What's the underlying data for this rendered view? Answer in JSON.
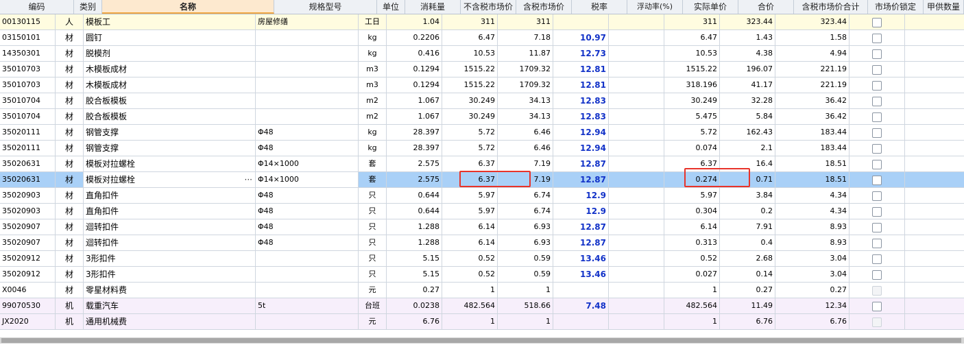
{
  "columns": [
    "编码",
    "类别",
    "名称",
    "规格型号",
    "单位",
    "消耗量",
    "不含税市场价",
    "含税市场价",
    "税率",
    "浮动率(%)",
    "实际单价",
    "合价",
    "含税市场价合计",
    "市场价锁定",
    "甲供数量"
  ],
  "rows": [
    {
      "code": "00130115",
      "type": "人",
      "name": "模板工",
      "spec": "房屋修缮",
      "unit": "工日",
      "qty": "1.04",
      "price_ex": "311",
      "price_in": "311",
      "tax": "",
      "float": "",
      "actual": "311",
      "total": "323.44",
      "total_in": "323.44",
      "lock": "enabled",
      "kind": "labor"
    },
    {
      "code": "03150101",
      "type": "材",
      "name": "圆钉",
      "spec": "",
      "unit": "kg",
      "qty": "0.2206",
      "price_ex": "6.47",
      "price_in": "7.18",
      "tax": "10.97",
      "float": "",
      "actual": "6.47",
      "total": "1.43",
      "total_in": "1.58",
      "lock": "enabled",
      "kind": "mat"
    },
    {
      "code": "14350301",
      "type": "材",
      "name": "脱模剂",
      "spec": "",
      "unit": "kg",
      "qty": "0.416",
      "price_ex": "10.53",
      "price_in": "11.87",
      "tax": "12.73",
      "float": "",
      "actual": "10.53",
      "total": "4.38",
      "total_in": "4.94",
      "lock": "enabled",
      "kind": "mat"
    },
    {
      "code": "35010703",
      "type": "材",
      "name": "木模板成材",
      "spec": "",
      "unit": "m3",
      "qty": "0.1294",
      "price_ex": "1515.22",
      "price_in": "1709.32",
      "tax": "12.81",
      "float": "",
      "actual": "1515.22",
      "total": "196.07",
      "total_in": "221.19",
      "lock": "enabled",
      "kind": "mat"
    },
    {
      "code": "35010703",
      "type": "材",
      "name": "木模板成材",
      "spec": "",
      "unit": "m3",
      "qty": "0.1294",
      "price_ex": "1515.22",
      "price_in": "1709.32",
      "tax": "12.81",
      "float": "",
      "actual": "318.196",
      "total": "41.17",
      "total_in": "221.19",
      "lock": "enabled",
      "kind": "mat"
    },
    {
      "code": "35010704",
      "type": "材",
      "name": "胶合板模板",
      "spec": "",
      "unit": "m2",
      "qty": "1.067",
      "price_ex": "30.249",
      "price_in": "34.13",
      "tax": "12.83",
      "float": "",
      "actual": "30.249",
      "total": "32.28",
      "total_in": "36.42",
      "lock": "enabled",
      "kind": "mat"
    },
    {
      "code": "35010704",
      "type": "材",
      "name": "胶合板模板",
      "spec": "",
      "unit": "m2",
      "qty": "1.067",
      "price_ex": "30.249",
      "price_in": "34.13",
      "tax": "12.83",
      "float": "",
      "actual": "5.475",
      "total": "5.84",
      "total_in": "36.42",
      "lock": "enabled",
      "kind": "mat"
    },
    {
      "code": "35020111",
      "type": "材",
      "name": "钢管支撑",
      "spec": "Φ48",
      "unit": "kg",
      "qty": "28.397",
      "price_ex": "5.72",
      "price_in": "6.46",
      "tax": "12.94",
      "float": "",
      "actual": "5.72",
      "total": "162.43",
      "total_in": "183.44",
      "lock": "enabled",
      "kind": "mat"
    },
    {
      "code": "35020111",
      "type": "材",
      "name": "钢管支撑",
      "spec": "Φ48",
      "unit": "kg",
      "qty": "28.397",
      "price_ex": "5.72",
      "price_in": "6.46",
      "tax": "12.94",
      "float": "",
      "actual": "0.074",
      "total": "2.1",
      "total_in": "183.44",
      "lock": "enabled",
      "kind": "mat"
    },
    {
      "code": "35020631",
      "type": "材",
      "name": "模板对拉螺栓",
      "spec": "Φ14×1000",
      "unit": "套",
      "qty": "2.575",
      "price_ex": "6.37",
      "price_in": "7.19",
      "tax": "12.87",
      "float": "",
      "actual": "6.37",
      "total": "16.4",
      "total_in": "18.51",
      "lock": "enabled",
      "kind": "mat"
    },
    {
      "code": "35020631",
      "type": "材",
      "name": "模板对拉螺栓",
      "spec": "Φ14×1000",
      "unit": "套",
      "qty": "2.575",
      "price_ex": "6.37",
      "price_in": "7.19",
      "tax": "12.87",
      "float": "",
      "actual": "0.274",
      "total": "0.71",
      "total_in": "18.51",
      "lock": "enabled",
      "kind": "selected"
    },
    {
      "code": "35020903",
      "type": "材",
      "name": "直角扣件",
      "spec": "Φ48",
      "unit": "只",
      "qty": "0.644",
      "price_ex": "5.97",
      "price_in": "6.74",
      "tax": "12.9",
      "float": "",
      "actual": "5.97",
      "total": "3.84",
      "total_in": "4.34",
      "lock": "enabled",
      "kind": "mat"
    },
    {
      "code": "35020903",
      "type": "材",
      "name": "直角扣件",
      "spec": "Φ48",
      "unit": "只",
      "qty": "0.644",
      "price_ex": "5.97",
      "price_in": "6.74",
      "tax": "12.9",
      "float": "",
      "actual": "0.304",
      "total": "0.2",
      "total_in": "4.34",
      "lock": "enabled",
      "kind": "mat"
    },
    {
      "code": "35020907",
      "type": "材",
      "name": "迴转扣件",
      "spec": "Φ48",
      "unit": "只",
      "qty": "1.288",
      "price_ex": "6.14",
      "price_in": "6.93",
      "tax": "12.87",
      "float": "",
      "actual": "6.14",
      "total": "7.91",
      "total_in": "8.93",
      "lock": "enabled",
      "kind": "mat"
    },
    {
      "code": "35020907",
      "type": "材",
      "name": "迴转扣件",
      "spec": "Φ48",
      "unit": "只",
      "qty": "1.288",
      "price_ex": "6.14",
      "price_in": "6.93",
      "tax": "12.87",
      "float": "",
      "actual": "0.313",
      "total": "0.4",
      "total_in": "8.93",
      "lock": "enabled",
      "kind": "mat"
    },
    {
      "code": "35020912",
      "type": "材",
      "name": "3形扣件",
      "spec": "",
      "unit": "只",
      "qty": "5.15",
      "price_ex": "0.52",
      "price_in": "0.59",
      "tax": "13.46",
      "float": "",
      "actual": "0.52",
      "total": "2.68",
      "total_in": "3.04",
      "lock": "enabled",
      "kind": "mat"
    },
    {
      "code": "35020912",
      "type": "材",
      "name": "3形扣件",
      "spec": "",
      "unit": "只",
      "qty": "5.15",
      "price_ex": "0.52",
      "price_in": "0.59",
      "tax": "13.46",
      "float": "",
      "actual": "0.027",
      "total": "0.14",
      "total_in": "3.04",
      "lock": "enabled",
      "kind": "mat"
    },
    {
      "code": "X0046",
      "type": "材",
      "name": "零星材料费",
      "spec": "",
      "unit": "元",
      "qty": "0.27",
      "price_ex": "1",
      "price_in": "1",
      "tax": "",
      "float": "",
      "actual": "1",
      "total": "0.27",
      "total_in": "0.27",
      "lock": "disabled",
      "kind": "mat"
    },
    {
      "code": "99070530",
      "type": "机",
      "name": "载重汽车",
      "spec": "5t",
      "unit": "台班",
      "qty": "0.0238",
      "price_ex": "482.564",
      "price_in": "518.66",
      "tax": "7.48",
      "float": "",
      "actual": "482.564",
      "total": "11.49",
      "total_in": "12.34",
      "lock": "enabled",
      "kind": "machine"
    },
    {
      "code": "JX2020",
      "type": "机",
      "name": "通用机械费",
      "spec": "",
      "unit": "元",
      "qty": "6.76",
      "price_ex": "1",
      "price_in": "1",
      "tax": "",
      "float": "",
      "actual": "1",
      "total": "6.76",
      "total_in": "6.76",
      "lock": "disabled",
      "kind": "machine"
    }
  ],
  "colors": {
    "tax_text": "#1232c8",
    "selected_row": "#a9d0f7",
    "labor_row": "#fffce0",
    "machine_row": "#f7effb",
    "highlight_box": "#e8332a"
  },
  "icons": {
    "ellipsis": "ellipsis-icon",
    "checkbox": "lock-checkbox"
  },
  "ellipsis_glyph": "···"
}
